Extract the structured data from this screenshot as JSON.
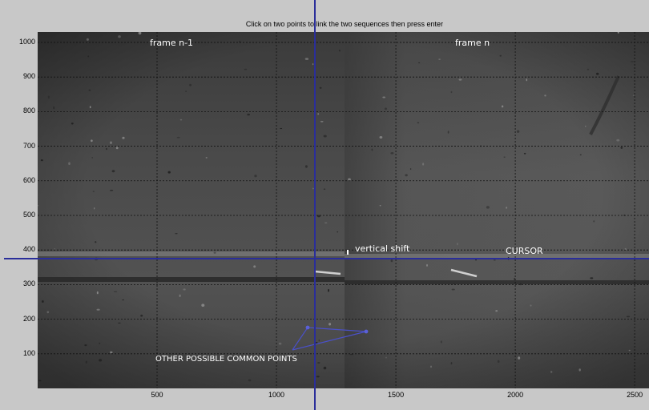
{
  "window": {
    "title": "Click on two points to link the two sequences then press enter"
  },
  "axes": {
    "xlim": [
      0,
      2560
    ],
    "ylim": [
      0,
      1030
    ],
    "xticks": [
      500,
      1000,
      1500,
      2000,
      2500
    ],
    "yticks": [
      100,
      200,
      300,
      400,
      500,
      600,
      700,
      800,
      900,
      1000
    ],
    "grid": true,
    "image_split_x": 1280
  },
  "annotations": {
    "frame_left": "frame n-1",
    "frame_right": "frame n",
    "vertical_shift": "vertical shift",
    "cursor": "CURSOR",
    "common_points": "OTHER POSSIBLE COMMON POINTS"
  },
  "cursor": {
    "x": 1160,
    "y": 377,
    "color": "#2a2e9a"
  },
  "colors": {
    "figure_bg": "#c8c8c8",
    "grid": "#111111",
    "annotation_text": "#ffffff",
    "pointer_lines": "#4a50c8"
  }
}
